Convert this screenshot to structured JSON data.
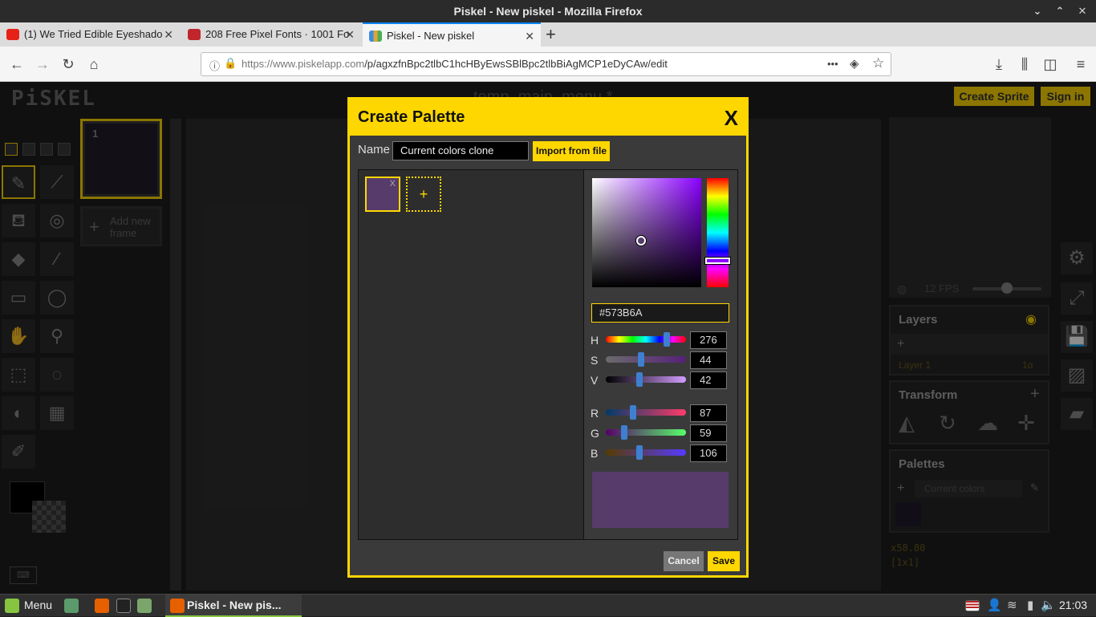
{
  "window": {
    "title": "Piskel - New piskel - Mozilla Firefox",
    "controls": [
      "⌄",
      "⌃",
      "✕"
    ]
  },
  "tabs": [
    {
      "label": "(1) We Tried Edible Eyeshado",
      "favicon_color": "#e62117"
    },
    {
      "label": "208 Free Pixel Fonts · 1001 Fo",
      "favicon_color": "#c0262c"
    },
    {
      "label": "Piskel - New piskel",
      "favicon_color": "#3b8de0",
      "active": true
    }
  ],
  "new_tab_symbol": "+",
  "nav": {
    "back": "←",
    "forward": "→",
    "reload": "↻",
    "home": "⌂",
    "url_domain": "https://www.piskelapp.com",
    "url_path": "/p/agxzfnBpc2tlbC1hcHByEwsSBlBpc2tlbBiAgMCP1eDyCAw/edit",
    "more": "•••",
    "pocket": "◈",
    "star": "☆",
    "download": "⤓",
    "library": "⫼",
    "sidebar": "◫",
    "menu": "≡"
  },
  "piskel": {
    "logo": "PiSKEL",
    "doc_title": "temp_main_menu *",
    "create_sprite": "Create Sprite",
    "sign_in": "Sign in",
    "frame_number": "1",
    "add_new_frame": "Add new frame",
    "fps_label": "12 FPS",
    "layers_title": "Layers",
    "layer_name": "Layer 1",
    "layer_opacity": "1α",
    "transform_title": "Transform",
    "palettes_title": "Palettes",
    "palette_select": "Current colors",
    "coords": "x58.80",
    "dimensions": "[1x1]"
  },
  "dialog": {
    "title": "Create Palette",
    "close": "X",
    "name_label": "Name",
    "name_value": "Current colors clone",
    "import_button": "Import from file",
    "swatch_remove": "X",
    "add_swatch": "+",
    "hex_value": "#573B6A",
    "hsv": [
      {
        "label": "H",
        "value": "276",
        "fraction": 0.76
      },
      {
        "label": "S",
        "value": "44",
        "fraction": 0.44
      },
      {
        "label": "V",
        "value": "42",
        "fraction": 0.42
      }
    ],
    "rgb": [
      {
        "label": "R",
        "value": "87",
        "fraction": 0.34
      },
      {
        "label": "G",
        "value": "59",
        "fraction": 0.23
      },
      {
        "label": "B",
        "value": "106",
        "fraction": 0.42
      }
    ],
    "preview_color": "#573B6A",
    "cancel_button": "Cancel",
    "save_button": "Save"
  },
  "taskbar": {
    "menu_label": "Menu",
    "active_window": "Piskel - New pis...",
    "clock": "21:03"
  },
  "colors": {
    "accent": "#ffd700",
    "current_color": "#573b6a"
  }
}
